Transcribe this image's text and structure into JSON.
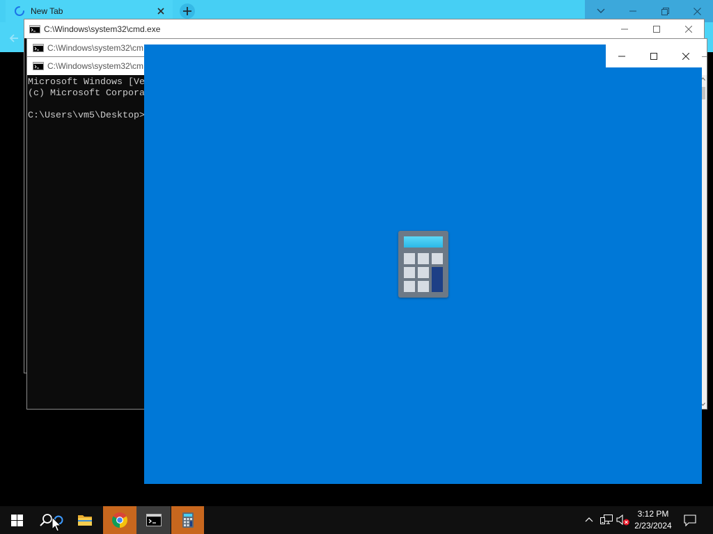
{
  "browser": {
    "tab": {
      "title": "New Tab",
      "loading_icon": "spinner-icon",
      "close_icon": "close-icon"
    },
    "new_tab_icon": "plus-icon",
    "back_icon": "back-arrow-icon",
    "caption_icons": [
      "chevron-down-icon",
      "minimize-icon",
      "restore-icon",
      "close-icon"
    ]
  },
  "cmd_windows": [
    {
      "title": "C:\\Windows\\system32\\cmd.exe"
    },
    {
      "title": "C:\\Windows\\system32\\cm"
    },
    {
      "title": "C:\\Windows\\system32\\cm"
    }
  ],
  "console": {
    "lines": [
      "Microsoft Windows [Ve",
      "(c) Microsoft Corpora",
      "C:\\Users\\vm5\\Desktop>"
    ]
  },
  "calculator_splash": {
    "icon": "calculator-icon"
  },
  "taskbar": {
    "buttons": [
      {
        "icon": "windows-logo-icon"
      },
      {
        "icon": "search-icon"
      },
      {
        "icon": "file-explorer-icon"
      },
      {
        "icon": "chrome-icon",
        "state": "flashing"
      },
      {
        "icon": "command-prompt-icon",
        "state": "active"
      },
      {
        "icon": "calculator-icon",
        "state": "flashing"
      }
    ],
    "tray_icons": [
      "chevron-up-icon",
      "network-icon",
      "volume-muted-icon"
    ],
    "clock": {
      "time": "3:12 PM",
      "date": "2/23/2024"
    },
    "notification_icon": "action-center-icon"
  },
  "colors": {
    "browser_frame": "#46cff4",
    "browser_toolbar": "#4cd4f7",
    "browser_caption_area": "#3ca8db",
    "console_background": "#0c0c0c",
    "console_text": "#cccccc",
    "calculator_splash": "#0078d7",
    "taskbar": "#101010",
    "taskbar_flashing": "#c8671e",
    "taskbar_active": "#3c3c3c"
  }
}
